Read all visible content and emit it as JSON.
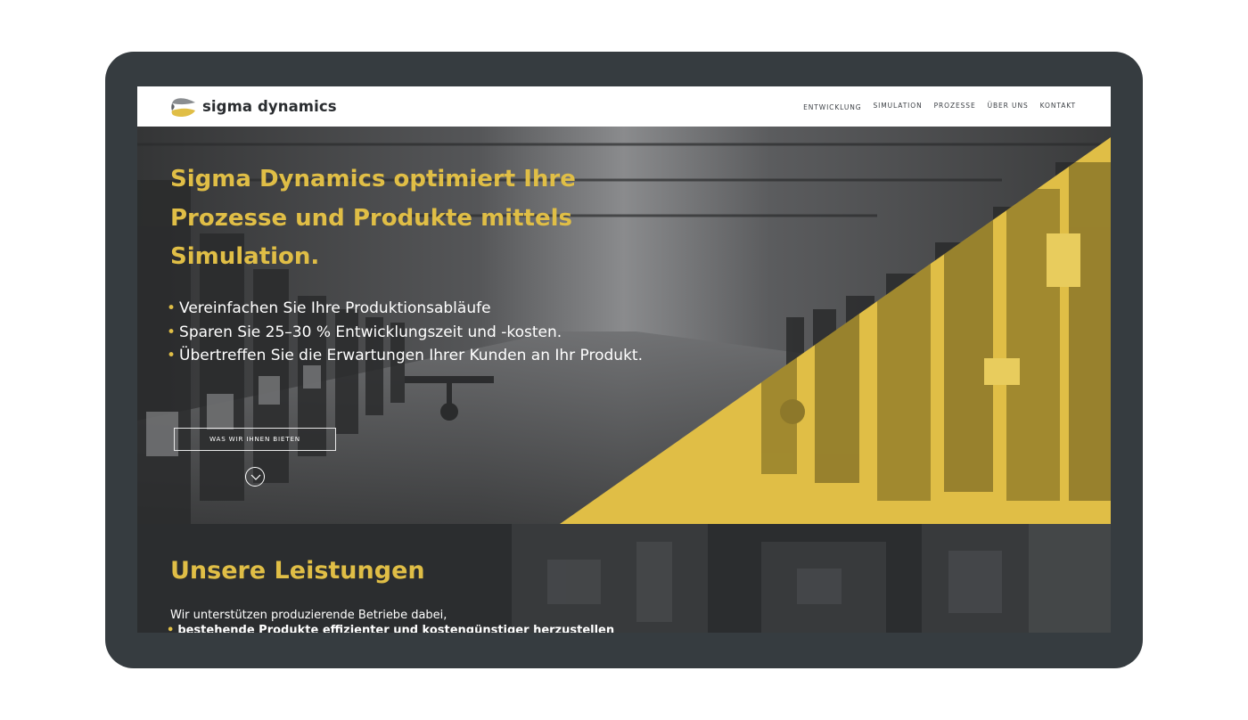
{
  "brand": {
    "name": "sigma dynamics",
    "colors": {
      "accent": "#e0be46",
      "frame": "#363c40",
      "header_bg": "#ffffff",
      "dark_text": "#2a2d30"
    }
  },
  "nav": {
    "items": [
      {
        "label": "ENTWICKLUNG"
      },
      {
        "label": "SIMULATION"
      },
      {
        "label": "PROZESSE"
      },
      {
        "label": "ÜBER UNS"
      },
      {
        "label": "KONTAKT"
      }
    ]
  },
  "hero": {
    "title": "Sigma Dynamics optimiert Ihre Prozesse und Produkte mittels Simulation.",
    "bullets": [
      "Vereinfachen Sie Ihre Produktionsabläufe",
      "Sparen Sie 25–30 % Entwicklungszeit und -kosten.",
      "Übertreffen Sie die Erwartungen Ihrer Kunden an Ihr Produkt."
    ],
    "bullet_marker": "•",
    "cta_label": "WAS WIR IHNEN BIETEN",
    "scroll_icon": "chevron-down-icon"
  },
  "services": {
    "title": "Unsere Leistungen",
    "intro": "Wir unterstützen produzierende Betriebe dabei,",
    "bullets": [
      "bestehende Produkte effizienter und kostengünstiger herzustellen"
    ]
  }
}
